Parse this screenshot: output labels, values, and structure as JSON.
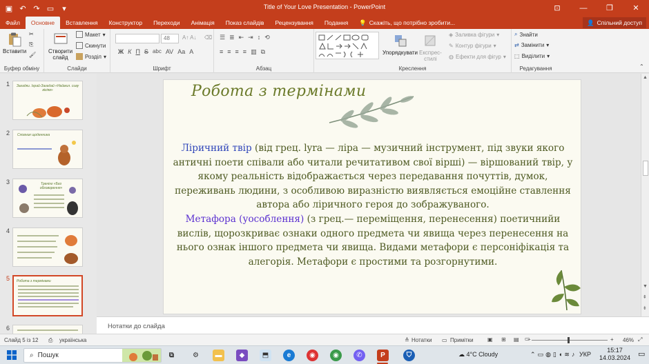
{
  "titlebar": {
    "title": "Title of Your Love Presentation  -  PowerPoint",
    "qat_icons": [
      "save-icon",
      "undo-icon",
      "redo-icon",
      "present-from-start-icon",
      "customize-qat-icon"
    ]
  },
  "tabs": {
    "items": [
      "Файл",
      "Основне",
      "Вставлення",
      "Конструктор",
      "Переходи",
      "Анімація",
      "Показ слайдів",
      "Рецензування",
      "Подання"
    ],
    "active": "Основне",
    "tellme": "Скажіть, що потрібно зробити...",
    "share": "Спільний доступ"
  },
  "ribbon": {
    "clipboard": {
      "label": "Буфер обміну",
      "paste": "Вставити"
    },
    "slides": {
      "label": "Слайди",
      "new_slide_line1": "Створити",
      "new_slide_line2": "слайд",
      "layout": "Макет",
      "reset": "Скинути",
      "section": "Розділ"
    },
    "font": {
      "label": "Шрифт",
      "size": "48",
      "bold": "Ж",
      "italic": "К",
      "underline": "П",
      "strike": "S",
      "abc": "abc"
    },
    "paragraph": {
      "label": "Абзац"
    },
    "drawing": {
      "label": "Креслення",
      "arrange": "Упорядкувати",
      "quick_styles_1": "Експрес-",
      "quick_styles_2": "стилі",
      "fill": "Заливка фігури",
      "outline": "Контур фігури",
      "effects": "Ефекти для фігур"
    },
    "editing": {
      "label": "Редагування",
      "find": "Знайти",
      "replace": "Замінити",
      "select": "Виділити"
    }
  },
  "thumbnails": [
    {
      "num": "1",
      "title": "Загадки. Іграй-Загадай «Наймил. сиву вігіяв»"
    },
    {
      "num": "2",
      "title": "Словник щоденника"
    },
    {
      "num": "3",
      "title": "Тренінг «Без обговорення»"
    },
    {
      "num": "4",
      "title": ""
    },
    {
      "num": "5",
      "title": "Робота з термінами"
    },
    {
      "num": "6",
      "title": ""
    }
  ],
  "slide": {
    "title": "Робота з термінами",
    "p1_term": "Ліричний твір",
    "p1_text": " (від грец. lyra — ліра — музичний інструмент, під звуки якого античні поети співали або читали речитативом свої вірші) — віршований твір, у якому реальність відображається через передавання почуттів, думок, переживань людини, з особливою виразністю виявляється емоційне ставлення автора або ліричного героя до зображуваного.",
    "p2_term": "Метафора (уособлення)",
    "p2_text": " (з грец.— переміщення, перенесення) поетичнийи вислів, щорозкриває ознаки одного предмета чи явища через перенесення на нього ознак іншого предмета чи явища. Видами метафори є персоніфікація та алегорія. Метафори є простими та розгорнутими."
  },
  "notes": {
    "placeholder": "Нотатки до слайда"
  },
  "statusbar": {
    "slide_counter": "Слайд 5 із 12",
    "language": "українська",
    "notes": "Нотатки",
    "comments": "Примітки",
    "zoom": "46%",
    "zoom_value": 46
  },
  "taskbar": {
    "search_placeholder": "Пошук",
    "weather": "4°C  Cloudy",
    "lang": "УКР",
    "time": "15:17",
    "date": "14.03.2024"
  },
  "colors": {
    "accent": "#c43e1c",
    "slide_text": "#4e5a22",
    "term_blue": "#2f45b9",
    "term_violet": "#5a2fd0",
    "title_green": "#6b7a2a"
  }
}
